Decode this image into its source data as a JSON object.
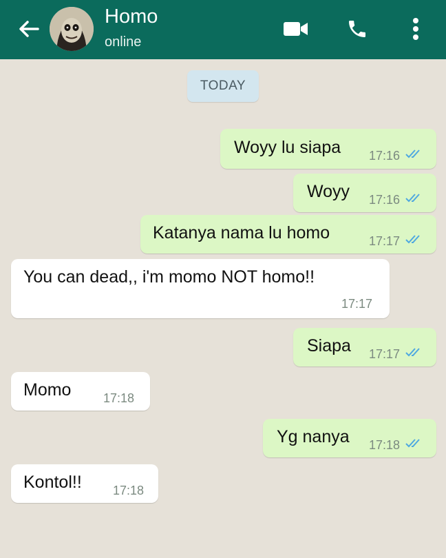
{
  "header": {
    "contact_name": "Homo",
    "status": "online",
    "icons": [
      "back-arrow-icon",
      "video-call-icon",
      "phone-icon",
      "more-options-icon"
    ],
    "background_color": "#0b6b5c"
  },
  "chat": {
    "date_label": "TODAY",
    "outgoing_bubble_color": "#dcf7c5",
    "incoming_bubble_color": "#ffffff",
    "read_tick_color": "#4fa8e0",
    "messages": [
      {
        "direction": "outgoing",
        "text": "Woyy lu siapa",
        "time": "17:16",
        "status": "read"
      },
      {
        "direction": "outgoing",
        "text": "Woyy",
        "time": "17:16",
        "status": "read"
      },
      {
        "direction": "outgoing",
        "text": "Katanya nama lu homo",
        "time": "17:17",
        "status": "read"
      },
      {
        "direction": "incoming",
        "text": "You can dead,, i'm momo NOT homo!!",
        "time": "17:17"
      },
      {
        "direction": "outgoing",
        "text": "Siapa",
        "time": "17:17",
        "status": "read"
      },
      {
        "direction": "incoming",
        "text": "Momo",
        "time": "17:18"
      },
      {
        "direction": "outgoing",
        "text": "Yg nanya",
        "time": "17:18",
        "status": "read"
      },
      {
        "direction": "incoming",
        "text": "Kontol!!",
        "time": "17:18"
      }
    ]
  }
}
